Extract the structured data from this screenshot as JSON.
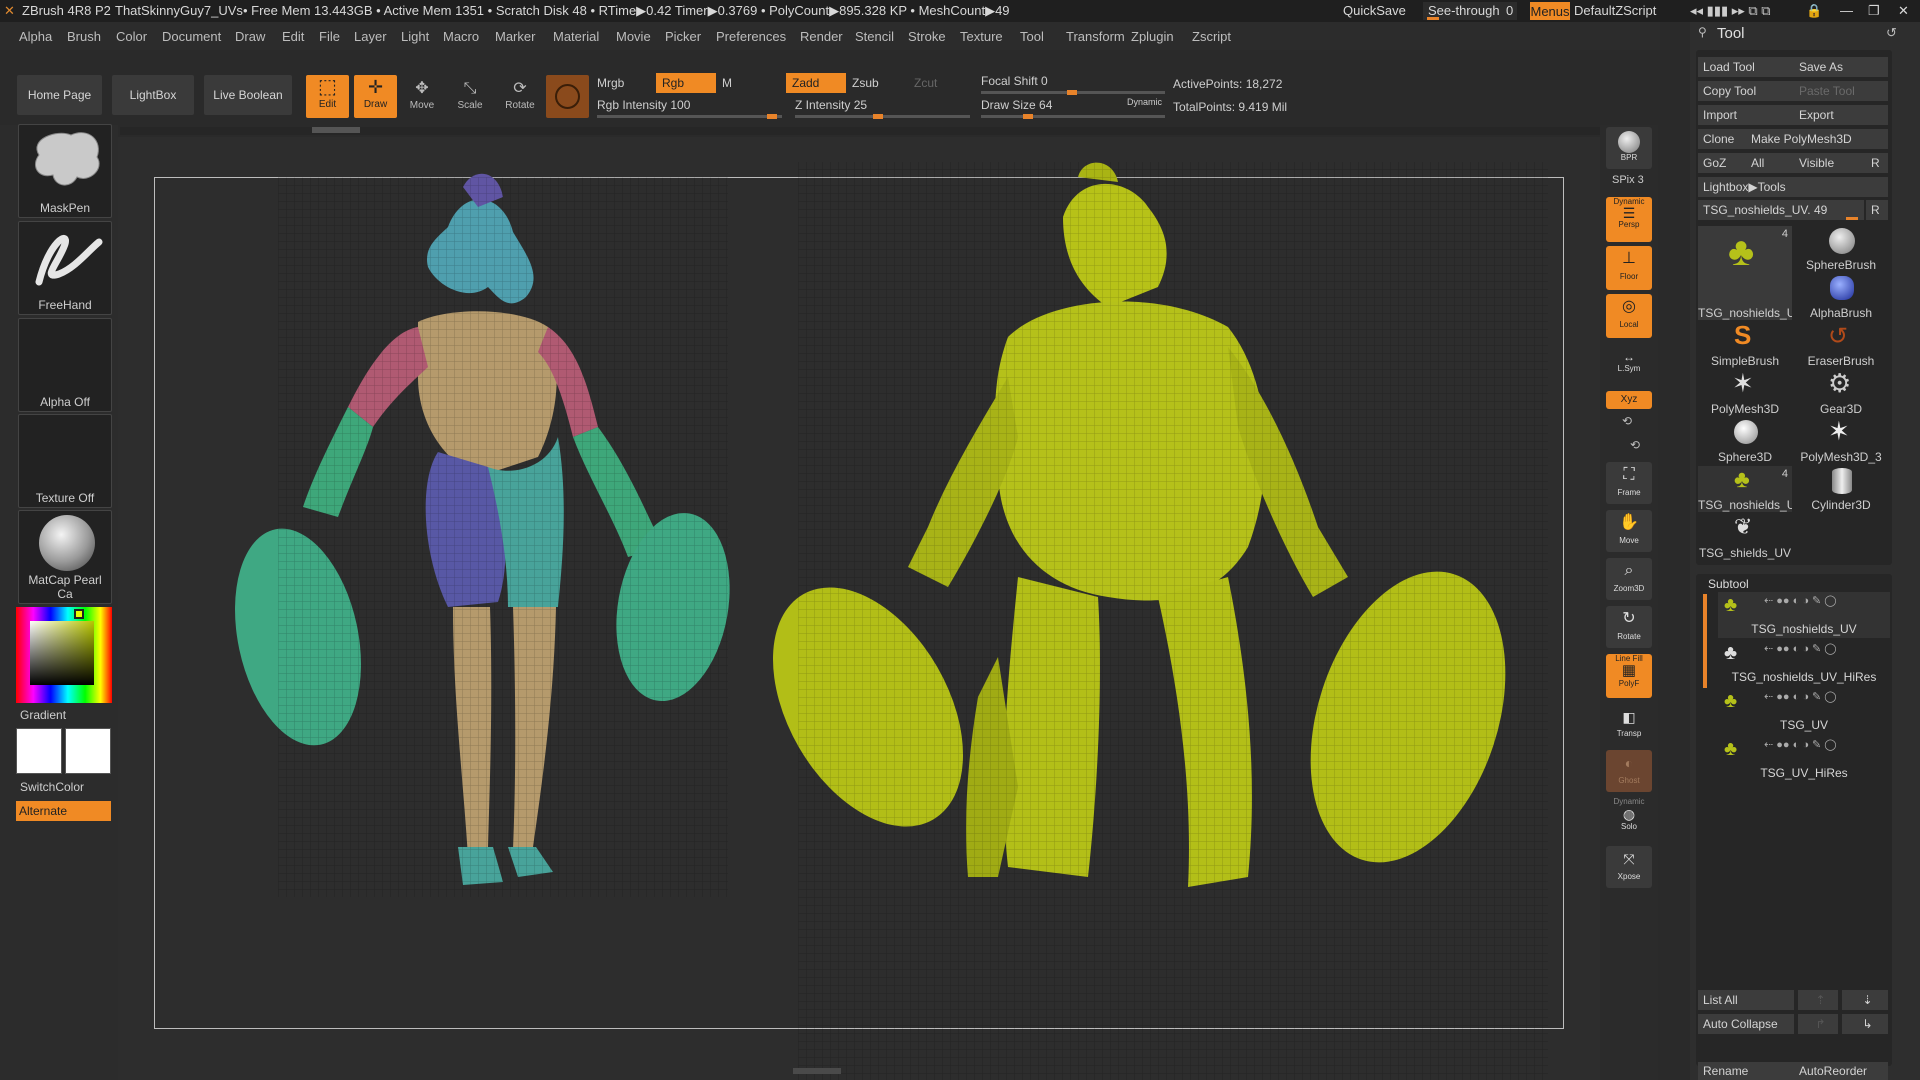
{
  "titlebar": {
    "app": "ZBrush 4R8 P2",
    "document": "ThatSkinnyGuy7_UVs",
    "stats": "• Free Mem 13.443GB • Active Mem 1351 • Scratch Disk 48 • RTime▶0.42 Timer▶0.3769 • PolyCount▶895.328 KP • MeshCount▶49",
    "quicksave": "QuickSave",
    "see_through": "See-through",
    "see_through_value": "0",
    "menus": "Menus",
    "script": "DefaultZScript"
  },
  "menubar": [
    "Alpha",
    "Brush",
    "Color",
    "Document",
    "Draw",
    "Edit",
    "File",
    "Layer",
    "Light",
    "Macro",
    "Marker",
    "Material",
    "Movie",
    "Picker",
    "Preferences",
    "Render",
    "Stencil",
    "Stroke",
    "Texture",
    "Tool",
    "Transform",
    "Zplugin",
    "Zscript"
  ],
  "topshelf": {
    "home": "Home Page",
    "lightbox": "LightBox",
    "live_boolean": "Live Boolean",
    "edit": "Edit",
    "draw": "Draw",
    "move": "Move",
    "scale": "Scale",
    "rotate": "Rotate",
    "mrgb": "Mrgb",
    "rgb": "Rgb",
    "m": "M",
    "rgb_intensity": "Rgb Intensity 100",
    "zadd": "Zadd",
    "zsub": "Zsub",
    "zcut": "Zcut",
    "z_intensity": "Z Intensity 25",
    "focal_shift": "Focal Shift 0",
    "draw_size": "Draw Size 64",
    "dynamic": "Dynamic",
    "active_points": "ActivePoints: 18,272",
    "total_points": "TotalPoints: 9.419 Mil"
  },
  "leftpanel": {
    "brush": "MaskPen",
    "stroke": "FreeHand",
    "alpha": "Alpha Off",
    "texture": "Texture Off",
    "material": "MatCap Pearl Ca",
    "gradient": "Gradient",
    "switchcolor": "SwitchColor",
    "alternate": "Alternate"
  },
  "rightshelf": {
    "bpr": "BPR",
    "spix": "SPix 3",
    "persp": "Persp",
    "floor": "Floor",
    "local": "Local",
    "lsym": "L.Sym",
    "xyz": "Xyz",
    "frame": "Frame",
    "move": "Move",
    "zoom3d": "Zoom3D",
    "rotate": "Rotate",
    "polyf": "PolyF",
    "transp": "Transp",
    "ghost": "Ghost",
    "solo": "Solo",
    "xpose": "Xpose",
    "dynamic": "Dynamic",
    "line_fill": "Line Fill"
  },
  "tool": {
    "title": "Tool",
    "load": "Load Tool",
    "save_as": "Save As",
    "copy": "Copy Tool",
    "paste": "Paste Tool",
    "import": "Import",
    "export": "Export",
    "clone": "Clone",
    "make_polymesh": "Make PolyMesh3D",
    "goz": "GoZ",
    "all": "All",
    "visible": "Visible",
    "r": "R",
    "lightbox_tools": "Lightbox▶Tools",
    "current": "TSG_noshields_UV. 49",
    "items": [
      {
        "label": "TSG_noshields_U",
        "badge": "4"
      },
      {
        "label": "SphereBrush",
        "badge": ""
      },
      {
        "label": "AlphaBrush",
        "badge": ""
      },
      {
        "label": "SimpleBrush",
        "badge": ""
      },
      {
        "label": "EraserBrush",
        "badge": ""
      },
      {
        "label": "PolyMesh3D",
        "badge": ""
      },
      {
        "label": "Gear3D",
        "badge": ""
      },
      {
        "label": "Sphere3D",
        "badge": ""
      },
      {
        "label": "PolyMesh3D_3",
        "badge": ""
      },
      {
        "label": "TSG_noshields_U",
        "badge": "4"
      },
      {
        "label": "Cylinder3D",
        "badge": ""
      },
      {
        "label": "TSG_shields_UV",
        "badge": ""
      }
    ],
    "subtool_title": "Subtool",
    "subtools": [
      "TSG_noshields_UV",
      "TSG_noshields_UV_HiRes",
      "TSG_UV",
      "TSG_UV_HiRes"
    ],
    "list_all": "List All",
    "auto_collapse": "Auto Collapse",
    "rename": "Rename",
    "autoreorder": "AutoReorder"
  }
}
